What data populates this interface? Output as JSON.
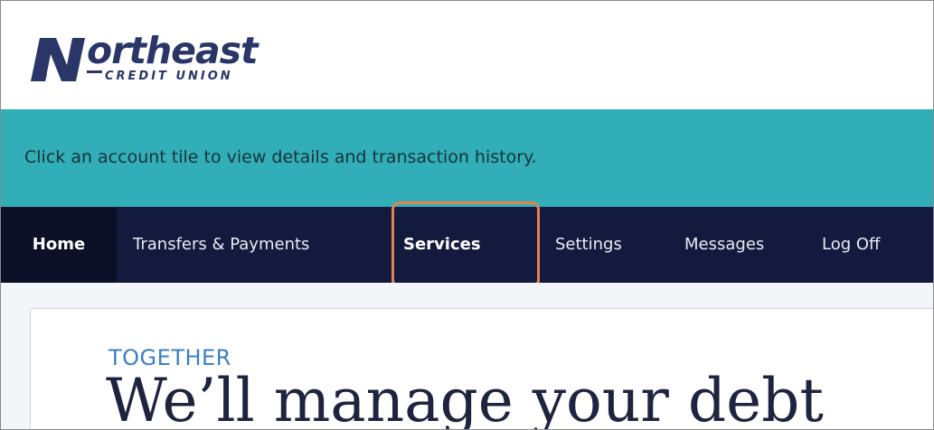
{
  "brand": {
    "name": "Northeast",
    "name_rest": "ortheast",
    "sub": "CREDIT UNION",
    "color": "#2a3668"
  },
  "info_bar": {
    "text": "Click an account tile to view details and transaction history.",
    "color": "#31aeb7"
  },
  "nav": {
    "background": "#141a3e",
    "items": [
      {
        "label": "Home",
        "active": true
      },
      {
        "label": "Transfers & Payments"
      },
      {
        "label": "Services",
        "highlighted": true
      },
      {
        "label": "Settings"
      },
      {
        "label": "Messages"
      },
      {
        "label": "Log Off"
      }
    ],
    "highlight_color": "#e2834c"
  },
  "promo": {
    "kicker": "TOGETHER",
    "headline": "We’ll manage your debt"
  }
}
